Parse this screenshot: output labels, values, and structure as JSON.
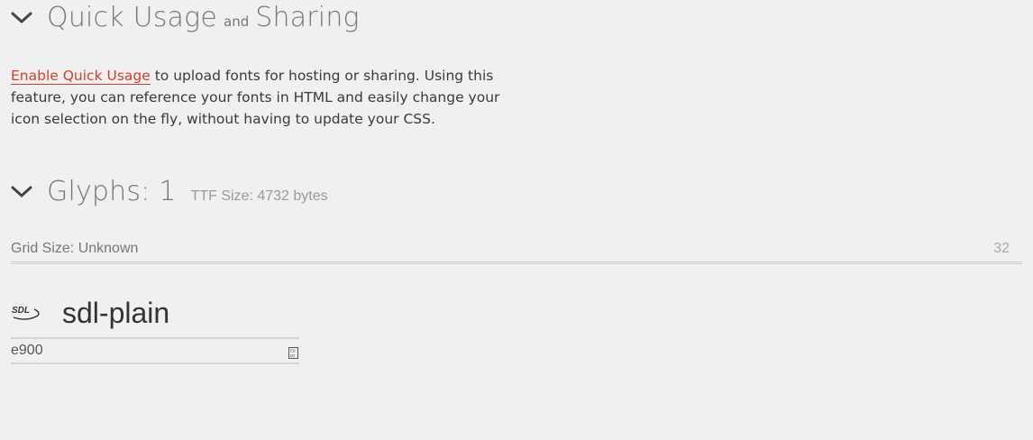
{
  "quick_usage": {
    "title_main": "Quick Usage",
    "title_and": "and",
    "title_end": "Sharing",
    "enable_link": "Enable Quick Usage",
    "intro_rest": " to upload fonts for hosting or sharing. Using this feature, you can reference your fonts in HTML and easily change your icon selection on the fly, without having to update your CSS."
  },
  "glyphs": {
    "title": "Glyphs: 1",
    "ttf_size": "TTF Size: 4732 bytes",
    "grid_label": "Grid Size: Unknown",
    "grid_value": "32",
    "items": [
      {
        "icon": "sdl-logo-icon",
        "name": "sdl-plain",
        "code": "e900"
      }
    ]
  },
  "colors": {
    "link": "#d4412b",
    "background": "#f0f0f0"
  }
}
